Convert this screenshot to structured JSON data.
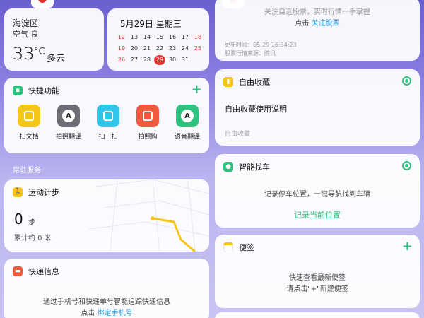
{
  "weather": {
    "district": "海淀区",
    "air_label": "空气",
    "air_quality": "良",
    "temperature": "33",
    "unit": "°C",
    "condition": "多云"
  },
  "calendar": {
    "title": "5月29日 星期三",
    "rows": [
      [
        "12",
        "13",
        "14",
        "15",
        "16",
        "17",
        "18"
      ],
      [
        "19",
        "20",
        "21",
        "22",
        "23",
        "24",
        "25"
      ],
      [
        "26",
        "27",
        "28",
        "29",
        "30",
        "31",
        ""
      ]
    ],
    "today": "29"
  },
  "quick": {
    "title": "快捷功能",
    "items": [
      {
        "label": "扫文档",
        "icon": "document-scan-icon",
        "color": "#f5c518"
      },
      {
        "label": "拍照翻译",
        "icon": "photo-translate-icon",
        "color": "#6d6d78",
        "glyph": "A"
      },
      {
        "label": "扫一扫",
        "icon": "scan-icon",
        "color": "#31c6e8"
      },
      {
        "label": "拍照购",
        "icon": "camera-shop-icon",
        "color": "#f05a3c"
      },
      {
        "label": "语音翻译",
        "icon": "voice-translate-icon",
        "color": "#2ec27e",
        "glyph": "A"
      }
    ]
  },
  "section": {
    "resident": "常驻服务"
  },
  "steps": {
    "title": "运动计步",
    "count": "0",
    "unit": "步",
    "total": "累计约 0 米"
  },
  "express": {
    "title": "快递信息",
    "desc": "通过手机号和快递单号智能追踪快递信息",
    "prefix": "点击",
    "link": "绑定手机号"
  },
  "stocks": {
    "top_text": "关注自选股票，实时行情一手掌握",
    "prefix": "点击",
    "link": "关注股票",
    "updated": "更新时间：05-29 16:34:23",
    "source": "股票行情来源：腾讯"
  },
  "favorites": {
    "title": "自由收藏",
    "guide": "自由收藏使用说明",
    "hint": "自由收藏"
  },
  "parking": {
    "title": "智能找车",
    "desc": "记录停车位置，一键导航找到车辆",
    "action": "记录当前位置"
  },
  "notes": {
    "title": "便签",
    "line1": "快速查看最新便签",
    "line2": "请点击\"+\"新建便签"
  },
  "colors": {
    "accent": "#2ec27e",
    "link": "#1a9bd7",
    "today": "#e8342e"
  }
}
